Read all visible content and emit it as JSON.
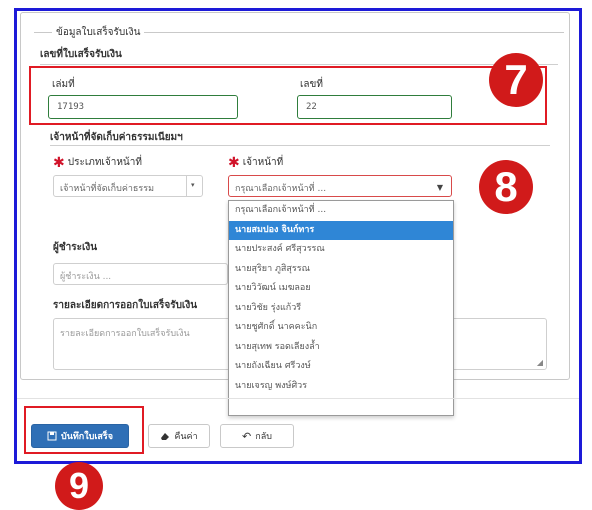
{
  "form": {
    "legend": "ข้อมูลใบเสร็จรับเงิน",
    "receipt_section_title": "เลขที่ใบเสร็จรับเงิน",
    "book_label": "เล่มที่",
    "book_value": "17193",
    "number_label": "เลขที่",
    "number_value": "22",
    "officer_section_title": "เจ้าหน้าที่จัดเก็บค่าธรรมเนียมฯ",
    "officer_type_label": "ประเภทเจ้าหน้าที่",
    "officer_type_value": "เจ้าหน้าที่จัดเก็บค่าธรรม",
    "officer_label": "เจ้าหน้าที่",
    "officer_value": "กรุณาเลือกเจ้าหน้าที่ ...",
    "payer_label": "ผู้ชำระเงิน",
    "payer_placeholder": "ผู้ชำระเงิน ...",
    "details_label": "รายละเอียดการออกใบเสร็จรับเงิน",
    "details_placeholder": "รายละเอียดการออกใบเสร็จรับเงิน"
  },
  "dropdown": {
    "options": [
      "กรุณาเลือกเจ้าหน้าที่ ...",
      "นายสมปอง จินก์ทาร",
      "นายประสงค์ ศรีสุวรรณ",
      "นายสุริยา ภูสิสุรรณ",
      "นายวิวัฒน์ เมฆลอย",
      "นายวิชัย รุ่งแก้วรี",
      "นายชูศักดิ์ นาคคะนิก",
      "นายสุเทพ รอดเลียงล้ำ",
      "นายถังเฉียน ศรีวงษ์",
      "นายเจรญ พงษ์ศิวร"
    ],
    "highlighted_index": 1
  },
  "buttons": {
    "save": "บันทึกใบเสร็จ",
    "reset": "คืนค่า",
    "back": "กลับ"
  },
  "badges": {
    "step_7": "7",
    "step_8": "8",
    "step_9": "9"
  },
  "colors": {
    "frame_blue": "#1d1ad8",
    "highlight_red": "#e01b24",
    "badge_red": "#d11a1a",
    "primary_blue": "#2f6fb6",
    "selected_option": "#2f86d6"
  }
}
